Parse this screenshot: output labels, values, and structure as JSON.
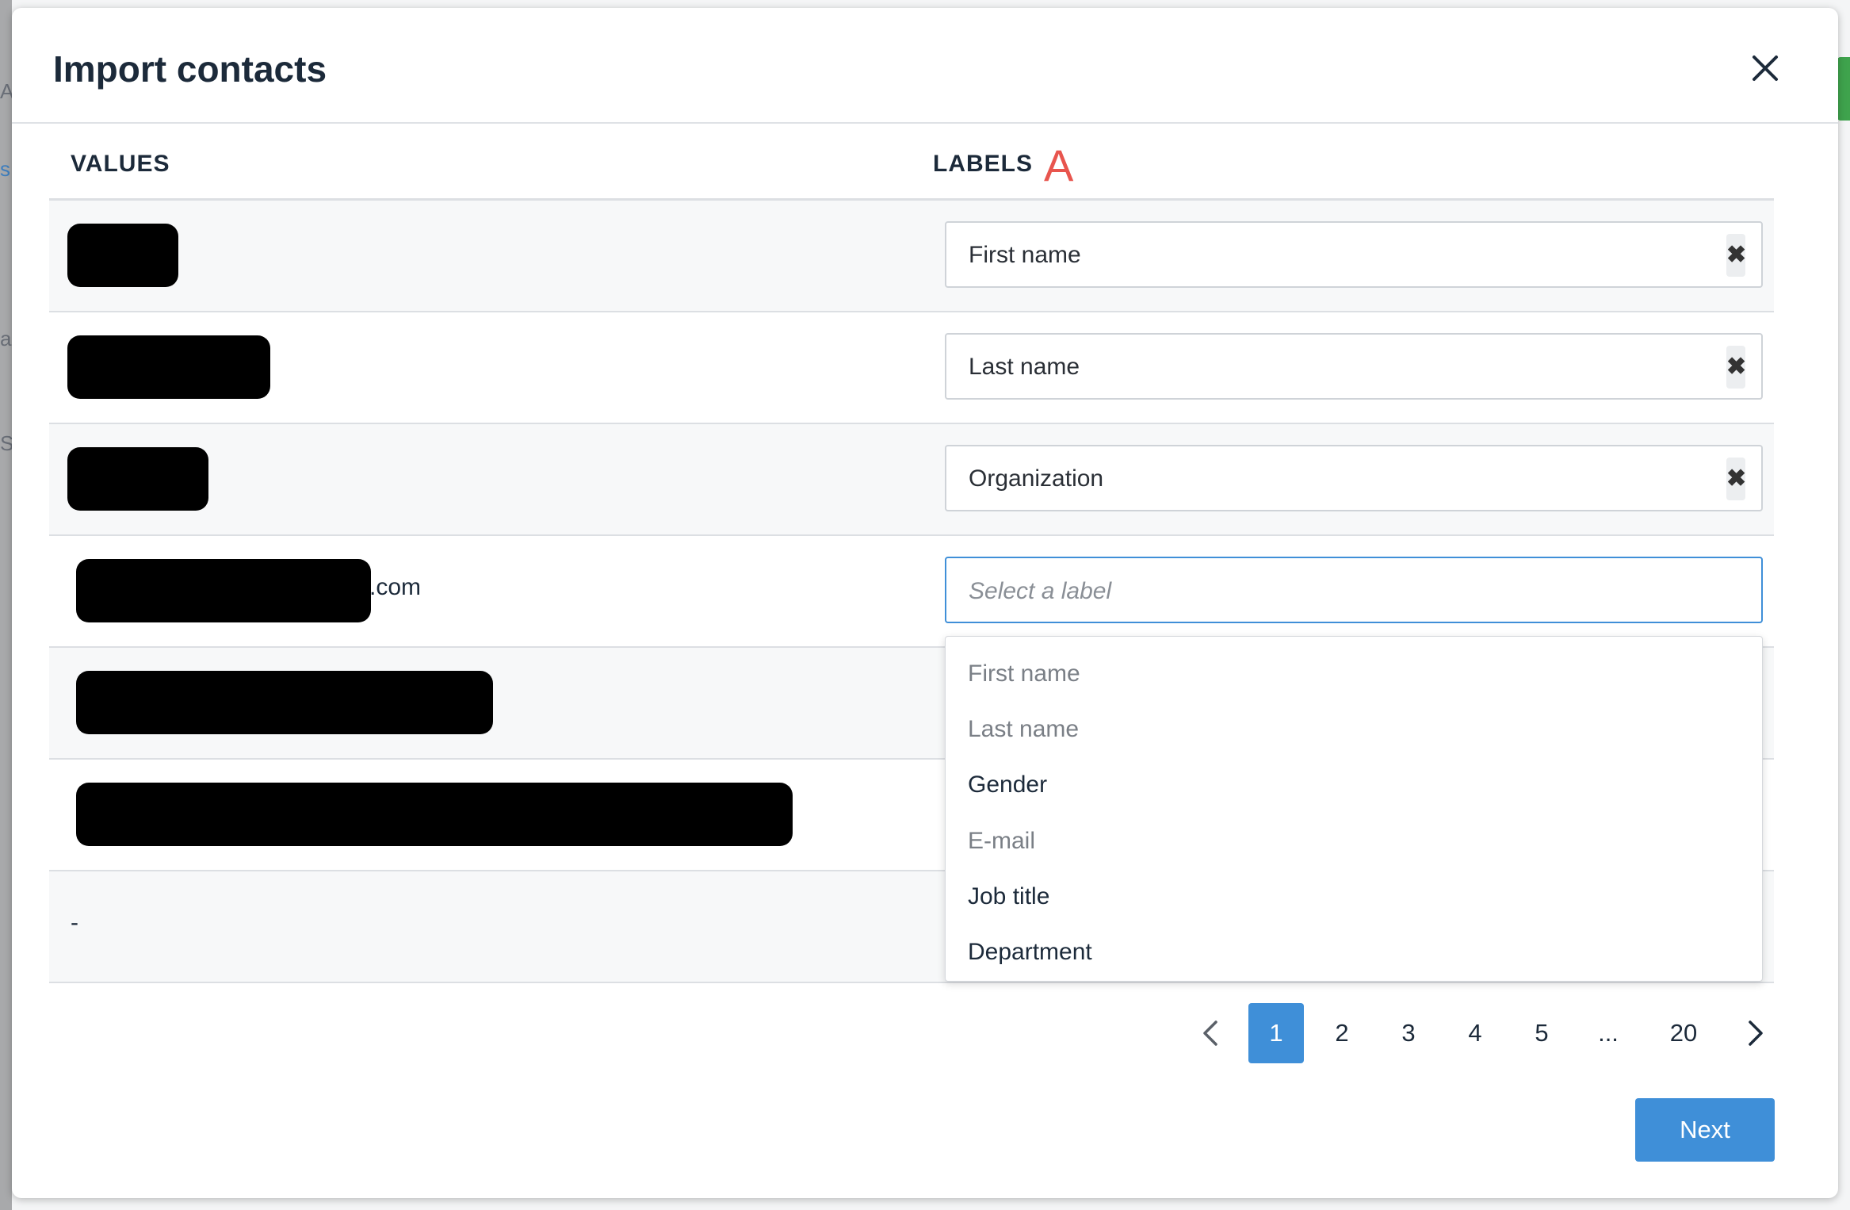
{
  "background": {
    "hints": [
      "A",
      "s",
      "a",
      "S"
    ]
  },
  "modal": {
    "title": "Import contacts",
    "close_icon": "close-icon"
  },
  "table": {
    "columns": {
      "values": "VALUES",
      "labels": "LABELS"
    },
    "label_indicator": "A",
    "rows": [
      {
        "value_suffix": "",
        "value_text": "",
        "label": "First name",
        "clear_icon": "clear-icon"
      },
      {
        "value_suffix": "",
        "value_text": "",
        "label": "Last name",
        "clear_icon": "clear-icon"
      },
      {
        "value_suffix": "",
        "value_text": "",
        "label": "Organization",
        "clear_icon": "clear-icon"
      },
      {
        "value_suffix": ".com",
        "value_text": "",
        "label": ""
      },
      {
        "value_suffix": "",
        "value_text": "",
        "label": ""
      },
      {
        "value_suffix": "",
        "value_text": "",
        "label": ""
      },
      {
        "value_suffix": "",
        "value_text": "-",
        "label": ""
      }
    ],
    "active_select_placeholder": "Select a label"
  },
  "dropdown": {
    "options": [
      {
        "label": "First name",
        "state": "used"
      },
      {
        "label": "Last name",
        "state": "used"
      },
      {
        "label": "Gender",
        "state": "available"
      },
      {
        "label": "E-mail",
        "state": "used"
      },
      {
        "label": "Job title",
        "state": "available"
      },
      {
        "label": "Department",
        "state": "available"
      }
    ]
  },
  "pagination": {
    "pages": [
      "1",
      "2",
      "3",
      "4",
      "5",
      "...",
      "20"
    ],
    "current": "1"
  },
  "footer": {
    "next_label": "Next"
  },
  "colors": {
    "accent": "#3f8fd8",
    "indicator": "#e8554e",
    "text": "#1c2a3a"
  }
}
